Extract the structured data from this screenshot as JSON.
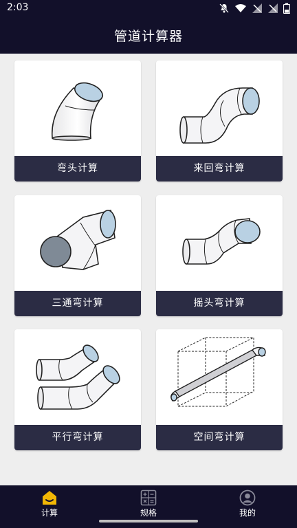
{
  "status_bar": {
    "time": "2:03",
    "icons": [
      "mute-icon",
      "wifi-icon",
      "signal-icon",
      "signal-icon",
      "battery-icon"
    ]
  },
  "header": {
    "title": "管道计算器"
  },
  "cards": [
    {
      "label": "弯头计算",
      "icon": "elbow-pipe-illustration"
    },
    {
      "label": "来回弯计算",
      "icon": "offset-pipe-illustration"
    },
    {
      "label": "三通弯计算",
      "icon": "tee-pipe-illustration"
    },
    {
      "label": "摇头弯计算",
      "icon": "rolling-offset-pipe-illustration"
    },
    {
      "label": "平行弯计算",
      "icon": "parallel-elbows-illustration"
    },
    {
      "label": "空间弯计算",
      "icon": "spatial-pipe-illustration"
    }
  ],
  "bottom_nav": {
    "items": [
      {
        "label": "计算",
        "icon": "home-icon",
        "active": true
      },
      {
        "label": "规格",
        "icon": "calculator-icon",
        "active": false
      },
      {
        "label": "我的",
        "icon": "profile-icon",
        "active": false
      }
    ]
  },
  "colors": {
    "header_bg": "#12102a",
    "card_label_bg": "#2b2c44",
    "active_nav": "#f2b705",
    "inactive_nav": "#8a8a99"
  }
}
